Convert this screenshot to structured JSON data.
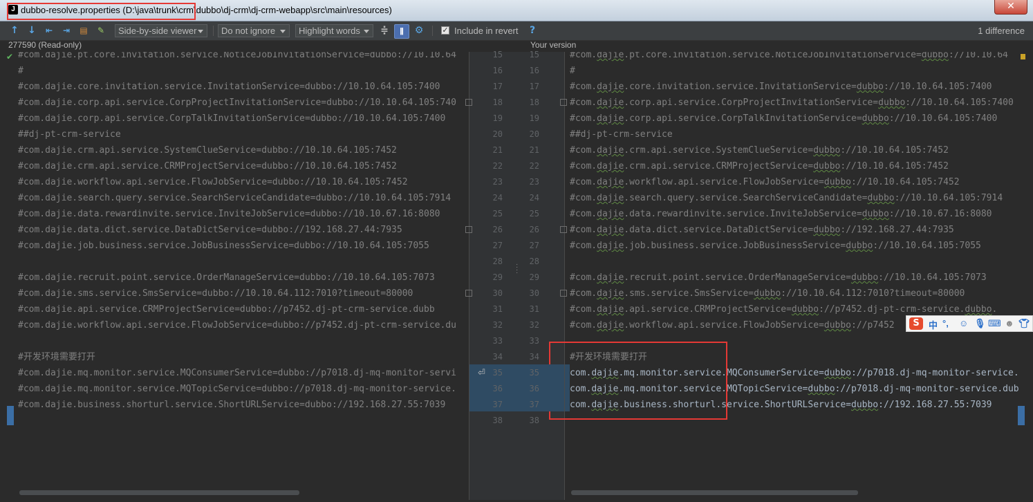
{
  "window": {
    "app_icon_letter": "J",
    "title": "dubbo-resolve.properties (D:\\java\\trunk\\crm\\dubbo\\dj-crm\\dj-crm-webapp\\src\\main\\resources)",
    "close_glyph": "✕"
  },
  "toolbar": {
    "viewer_mode": "Side-by-side viewer",
    "ignore_mode": "Do not ignore",
    "highlight_mode": "Highlight words",
    "include_in_revert": "Include in revert",
    "help": "?",
    "difference_count": "1 difference",
    "icons": [
      "arrow-up-icon",
      "arrow-down-icon",
      "previous-file-icon",
      "next-file-icon",
      "compare-icon",
      "edit-source-icon",
      "collapse-unchanged-icon",
      "sync-scroll-icon",
      "settings-icon"
    ]
  },
  "left_panel": {
    "header": "277590 (Read-only)"
  },
  "right_panel": {
    "header": "Your version"
  },
  "line_numbers_left": [
    "15",
    "16",
    "17",
    "18",
    "19",
    "20",
    "21",
    "22",
    "23",
    "24",
    "25",
    "26",
    "27",
    "28",
    "29",
    "30",
    "31",
    "32",
    "33",
    "34",
    "35",
    "36",
    "37",
    "38"
  ],
  "line_numbers_right": [
    "15",
    "16",
    "17",
    "18",
    "19",
    "20",
    "21",
    "22",
    "23",
    "24",
    "25",
    "26",
    "27",
    "28",
    "29",
    "30",
    "31",
    "32",
    "33",
    "34",
    "35",
    "36",
    "37",
    "38"
  ],
  "left_lines": [
    "#com.dajie.pt.core.invitation.service.NoticeJobInvitationService=dubbo://10.10.64",
    "#",
    "#com.dajie.core.invitation.service.InvitationService=dubbo://10.10.64.105:7400",
    "#com.dajie.corp.api.service.CorpProjectInvitationService=dubbo://10.10.64.105:740",
    "#com.dajie.corp.api.service.CorpTalkInvitationService=dubbo://10.10.64.105:7400",
    "##dj-pt-crm-service",
    "#com.dajie.crm.api.service.SystemClueService=dubbo://10.10.64.105:7452",
    "#com.dajie.crm.api.service.CRMProjectService=dubbo://10.10.64.105:7452",
    "#com.dajie.workflow.api.service.FlowJobService=dubbo://10.10.64.105:7452",
    "#com.dajie.search.query.service.SearchServiceCandidate=dubbo://10.10.64.105:7914",
    "#com.dajie.data.rewardinvite.service.InviteJobService=dubbo://10.10.67.16:8080",
    "#com.dajie.data.dict.service.DataDictService=dubbo://192.168.27.44:7935",
    "#com.dajie.job.business.service.JobBusinessService=dubbo://10.10.64.105:7055",
    "",
    "#com.dajie.recruit.point.service.OrderManageService=dubbo://10.10.64.105:7073",
    "#com.dajie.sms.service.SmsService=dubbo://10.10.64.112:7010?timeout=80000",
    "#com.dajie.api.service.CRMProjectService=dubbo://p7452.dj-pt-crm-service.dubb",
    "#com.dajie.workflow.api.service.FlowJobService=dubbo://p7452.dj-pt-crm-service.du",
    "",
    "#开发环境需要打开",
    "#com.dajie.mq.monitor.service.MQConsumerService=dubbo://p7018.dj-mq-monitor-servi",
    "#com.dajie.mq.monitor.service.MQTopicService=dubbo://p7018.dj-mq-monitor-service.",
    "#com.dajie.business.shorturl.service.ShortURLService=dubbo://192.168.27.55:7039",
    ""
  ],
  "right_lines": [
    "#com.dajie.pt.core.invitation.service.NoticeJobInvitationService=dubbo://10.10.64",
    "#",
    "#com.dajie.core.invitation.service.InvitationService=dubbo://10.10.64.105:7400",
    "#com.dajie.corp.api.service.CorpProjectInvitationService=dubbo://10.10.64.105:7400",
    "#com.dajie.corp.api.service.CorpTalkInvitationService=dubbo://10.10.64.105:7400",
    "##dj-pt-crm-service",
    "#com.dajie.crm.api.service.SystemClueService=dubbo://10.10.64.105:7452",
    "#com.dajie.crm.api.service.CRMProjectService=dubbo://10.10.64.105:7452",
    "#com.dajie.workflow.api.service.FlowJobService=dubbo://10.10.64.105:7452",
    "#com.dajie.search.query.service.SearchServiceCandidate=dubbo://10.10.64.105:7914",
    "#com.dajie.data.rewardinvite.service.InviteJobService=dubbo://10.10.67.16:8080",
    "#com.dajie.data.dict.service.DataDictService=dubbo://192.168.27.44:7935",
    "#com.dajie.job.business.service.JobBusinessService=dubbo://10.10.64.105:7055",
    "",
    "#com.dajie.recruit.point.service.OrderManageService=dubbo://10.10.64.105:7073",
    "#com.dajie.sms.service.SmsService=dubbo://10.10.64.112:7010?timeout=80000",
    "#com.dajie.api.service.CRMProjectService=dubbo://p7452.dj-pt-crm-service.dubbo.",
    "#com.dajie.workflow.api.service.FlowJobService=dubbo://p7452",
    "",
    "#开发环境需要打开",
    "com.dajie.mq.monitor.service.MQConsumerService=dubbo://p7018.dj-mq-monitor-service.",
    "com.dajie.mq.monitor.service.MQTopicService=dubbo://p7018.dj-mq-monitor-service.dub",
    "com.dajie.business.shorturl.service.ShortURLService=dubbo://192.168.27.55:7039",
    ""
  ],
  "ime_toolbar": {
    "logo": "S",
    "mode": "中",
    "punct": "°,",
    "icons": [
      "emoji-icon",
      "microphone-icon",
      "keyboard-icon",
      "user-icon",
      "shirt-icon"
    ]
  },
  "colors": {
    "editor_bg": "#2b2b2b",
    "changed_bg": "#2f4b63",
    "annotation_red": "#e53935"
  }
}
